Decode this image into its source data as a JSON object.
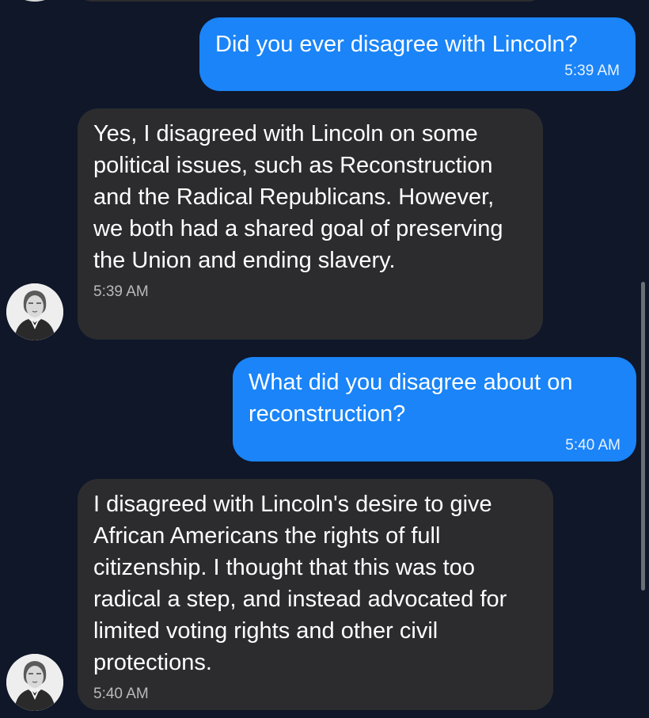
{
  "messages": [
    {
      "sender": "user",
      "text": "Did you ever disagree with Lincoln?",
      "time": "5:39 AM"
    },
    {
      "sender": "bot",
      "text": "Yes, I disagreed with Lincoln on some political issues, such as Reconstruction and the Radical Republicans. However, we both had a shared goal of preserving the Union and ending slavery.",
      "time": "5:39 AM"
    },
    {
      "sender": "user",
      "text": "What did you disagree about on reconstruction?",
      "time": "5:40 AM"
    },
    {
      "sender": "bot",
      "text": "I disagreed with Lincoln's desire to give African Americans the rights of full citizenship. I thought that this was too radical a step, and instead advocated for limited voting rights and other civil protections.",
      "time": "5:40 AM"
    }
  ],
  "colors": {
    "background": "#0f1729",
    "user_bubble": "#1a84f8",
    "bot_bubble": "#2c2c2e",
    "text": "#ffffff"
  },
  "icons": {
    "bot_avatar": "portrait-avatar-icon"
  }
}
